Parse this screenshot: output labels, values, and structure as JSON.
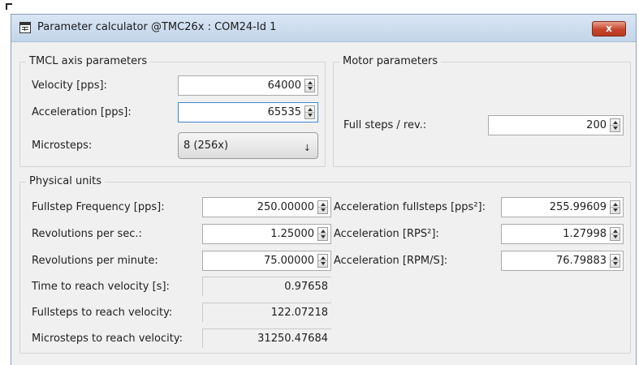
{
  "window": {
    "title": "Parameter calculator @TMC26x : COM24-Id 1",
    "close_label": "x"
  },
  "axis_group": {
    "title": "TMCL axis parameters",
    "velocity_label": "Velocity [pps]:",
    "velocity_value": "64000",
    "acceleration_label": "Acceleration [pps]:",
    "acceleration_value": "65535",
    "microsteps_label": "Microsteps:",
    "microsteps_value": "8 (256x)"
  },
  "motor_group": {
    "title": "Motor parameters",
    "fullsteps_label": "Full steps / rev.:",
    "fullsteps_value": "200"
  },
  "physical_group": {
    "title": "Physical units",
    "left": [
      {
        "label": "Fullstep Frequency [pps]:",
        "value": "250.00000"
      },
      {
        "label": "Revolutions per sec.:",
        "value": "1.25000"
      },
      {
        "label": "Revolutions per minute:",
        "value": "75.00000"
      },
      {
        "label": "Time to reach velocity [s]:",
        "value": "0.97658"
      },
      {
        "label": "Fullsteps to reach velocity:",
        "value": "122.07218"
      },
      {
        "label": "Microsteps to reach velocity:",
        "value": "31250.47684"
      }
    ],
    "right": [
      {
        "label": "Acceleration fullsteps [pps²]:",
        "value": "255.99609"
      },
      {
        "label": "Acceleration [RPS²]:",
        "value": "1.27998"
      },
      {
        "label": "Acceleration [RPM/S]:",
        "value": "76.79883"
      }
    ]
  }
}
